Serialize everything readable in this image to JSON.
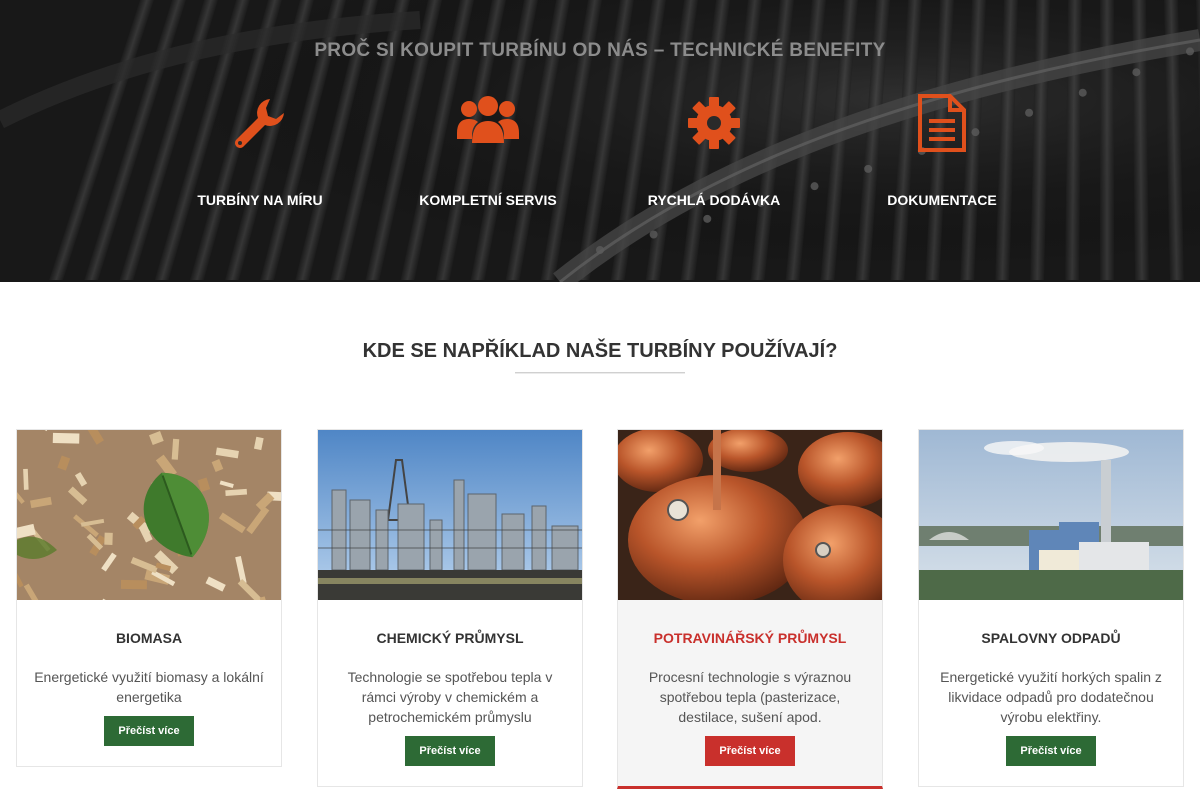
{
  "hero": {
    "title": "PROČ SI KOUPIT TURBÍNU OD NÁS – TECHNICKÉ BENEFITY",
    "accent_color": "#e0501c",
    "benefits": [
      {
        "icon": "wrench-icon",
        "label": "TURBÍNY NA MÍRU"
      },
      {
        "icon": "users-icon",
        "label": "KOMPLETNÍ SERVIS"
      },
      {
        "icon": "gear-icon",
        "label": "RYCHLÁ DODÁVKA"
      },
      {
        "icon": "document-icon",
        "label": "DOKUMENTACE"
      }
    ]
  },
  "section": {
    "title": "KDE SE NAPŘÍKLAD NAŠE TURBÍNY POUŽÍVAJÍ?"
  },
  "cards": [
    {
      "name": "BIOMASA",
      "description": "Energetické využití biomasy a lokální energetika",
      "button": "Přečíst více",
      "image": "wood-chips-photo",
      "active": false
    },
    {
      "name": "CHEMICKÝ PRŮMYSL",
      "description": "Technologie se spotřebou tepla v rámci výroby v chemickém a petrochemickém průmyslu",
      "button": "Přečíst více",
      "image": "chemical-plant-photo",
      "active": false
    },
    {
      "name": "POTRAVINÁŘSKÝ PRŮMYSL",
      "description": "Procesní technologie s výraznou spotřebou tepla (pasterizace, destilace, sušení apod.",
      "button": "Přečíst více",
      "image": "copper-brew-kettles-photo",
      "active": true
    },
    {
      "name": "SPALOVNY ODPADŮ",
      "description": "Energetické využití horkých spalin z likvidace odpadů pro dodatečnou výrobu elektřiny.",
      "button": "Přečíst více",
      "image": "waste-incinerator-photo",
      "active": false
    }
  ],
  "colors": {
    "button_green": "#2d6a35",
    "active_red": "#c9302c"
  }
}
